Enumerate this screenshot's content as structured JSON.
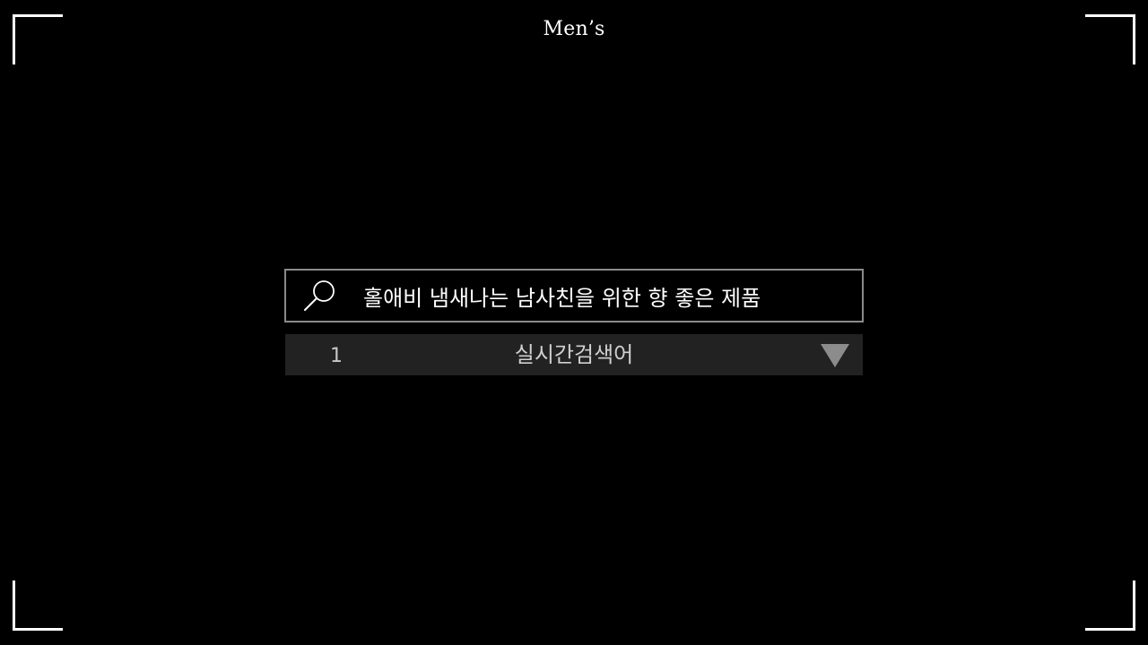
{
  "header": {
    "title": "Men’s"
  },
  "search": {
    "value": "홀애비 냄새나는 남사친을 위한 향 좋은 제품",
    "icon": "search-icon"
  },
  "trending": {
    "rank": "1",
    "label": "실시간검색어",
    "toggle_icon": "triangle-down-icon"
  },
  "colors": {
    "background": "#000000",
    "frame": "#ffffff",
    "search_border": "#8a8a8a",
    "dropdown_bg": "#232223",
    "arrow": "#8c8c8c"
  }
}
